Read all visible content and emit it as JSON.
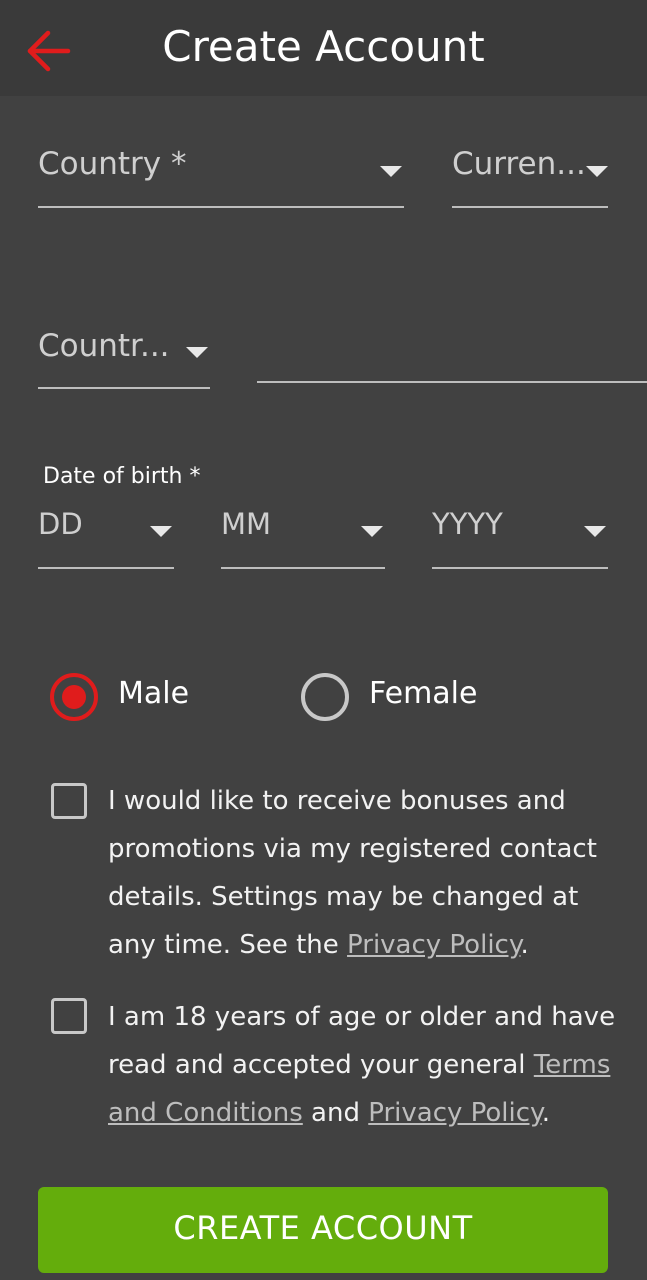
{
  "header": {
    "title": "Create Account",
    "back_icon": "arrow-left-icon",
    "accent": "#e01c1c"
  },
  "country": {
    "placeholder": "Country *"
  },
  "currency": {
    "placeholder": "Curren..."
  },
  "country_code": {
    "placeholder": "Countr..."
  },
  "phone": {
    "value": ""
  },
  "dob": {
    "label": "Date of birth *",
    "day": "DD",
    "month": "MM",
    "year": "YYYY"
  },
  "gender": {
    "options": [
      {
        "label": "Male",
        "selected": true
      },
      {
        "label": "Female",
        "selected": false
      }
    ]
  },
  "consents": {
    "bonuses": {
      "checked": false,
      "text": "I would like to receive bonuses and promotions via my registered contact details. Settings may be changed at any time. See the ",
      "link": "Privacy Policy",
      "end": "."
    },
    "age": {
      "checked": false,
      "text": "I am 18 years of age or older and have read and accepted your general ",
      "terms_link": "Terms and Conditions",
      "mid": " and ",
      "privacy_link": "Privacy Policy",
      "end": "."
    }
  },
  "cta": {
    "label": "CREATE ACCOUNT",
    "color": "#64ad0c"
  }
}
